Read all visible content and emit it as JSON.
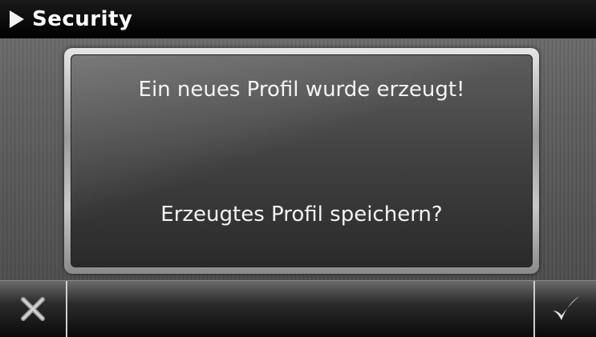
{
  "header": {
    "title": "Security",
    "icon": "play-arrow-icon"
  },
  "dialog": {
    "message": "Ein neues Profil wurde erzeugt!",
    "question": "Erzeugtes Profil speichern?"
  },
  "actions": {
    "cancel_icon": "close-x-icon",
    "confirm_icon": "checkmark-icon"
  },
  "colors": {
    "header_bg": "#000000",
    "text": "#f4f4f4",
    "dialog_bg": "#3e3e3e"
  }
}
